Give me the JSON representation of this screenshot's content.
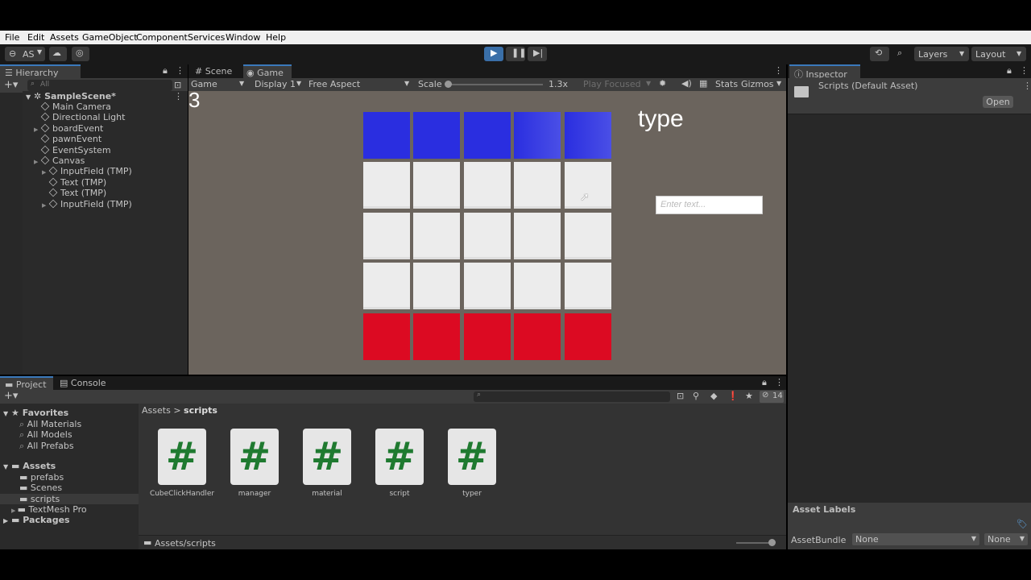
{
  "menu": [
    "File",
    "Edit",
    "Assets",
    "GameObject",
    "Component",
    "Services",
    "Window",
    "Help"
  ],
  "toolbar": {
    "account": "AS",
    "layers": "Layers",
    "layout": "Layout"
  },
  "hierarchy": {
    "tab": "Hierarchy",
    "search_placeholder": "All",
    "scene": "SampleScene*",
    "items": [
      {
        "label": "Main Camera",
        "indent": 0,
        "arrow": false
      },
      {
        "label": "Directional Light",
        "indent": 0,
        "arrow": false
      },
      {
        "label": "boardEvent",
        "indent": 0,
        "arrow": true
      },
      {
        "label": "pawnEvent",
        "indent": 0,
        "arrow": false
      },
      {
        "label": "EventSystem",
        "indent": 0,
        "arrow": false
      },
      {
        "label": "Canvas",
        "indent": 0,
        "arrow": true
      },
      {
        "label": "InputField (TMP)",
        "indent": 1,
        "arrow": true
      },
      {
        "label": "Text (TMP)",
        "indent": 1,
        "arrow": false
      },
      {
        "label": "Text (TMP)",
        "indent": 1,
        "arrow": false
      },
      {
        "label": "InputField (TMP)",
        "indent": 1,
        "arrow": true
      }
    ]
  },
  "game": {
    "tabs": [
      "Scene",
      "Game"
    ],
    "mode": "Game",
    "display": "Display 1",
    "aspect": "Free Aspect",
    "scale_label": "Scale",
    "scale_value": "1.3x",
    "play_focused": "Play Focused",
    "stats": "Stats",
    "gizmos": "Gizmos",
    "counter": "3",
    "title_text": "type",
    "input_placeholder": "Enter text...",
    "colors": {
      "blue": "#2a2ee0",
      "white": "#ececec",
      "red": "#dc0a22"
    },
    "rows": [
      "blue",
      "white",
      "white",
      "white",
      "red"
    ]
  },
  "inspector": {
    "tab": "Inspector",
    "asset_title": "Scripts (Default Asset)",
    "open_button": "Open",
    "asset_labels": "Asset Labels",
    "assetbundle_label": "AssetBundle",
    "assetbundle_value": "None",
    "variant_value": "None"
  },
  "project": {
    "tabs": [
      "Project",
      "Console"
    ],
    "hidden_count": "14",
    "favorites_label": "Favorites",
    "favorites": [
      "All Materials",
      "All Models",
      "All Prefabs"
    ],
    "assets_label": "Assets",
    "assets": [
      "prefabs",
      "Scenes",
      "scripts",
      "TextMesh Pro"
    ],
    "packages_label": "Packages",
    "breadcrumb": [
      "Assets",
      "scripts"
    ],
    "files": [
      "CubeClickHandler",
      "manager",
      "material",
      "script",
      "typer"
    ],
    "footer_path": "Assets/scripts"
  }
}
